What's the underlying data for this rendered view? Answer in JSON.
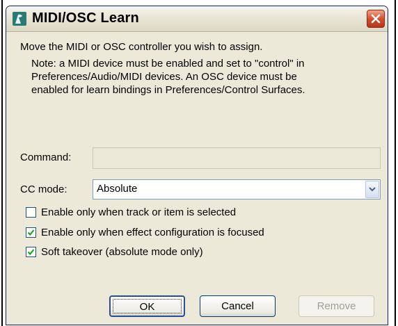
{
  "window": {
    "title": "MIDI/OSC Learn",
    "close_icon": "close-x-icon",
    "app_icon": "reaper-icon"
  },
  "body": {
    "intro": "Move the MIDI or OSC controller you wish to assign.",
    "note_lines": [
      "Note: a MIDI device must be enabled and set to \"control\" in",
      "Preferences/Audio/MIDI devices. An OSC device must be",
      "enabled for learn bindings in Preferences/Control Surfaces."
    ]
  },
  "form": {
    "command_label": "Command:",
    "command_value": "",
    "cc_mode_label": "CC mode:",
    "cc_mode_value": "Absolute"
  },
  "checkboxes": [
    {
      "label": "Enable only when track or item is selected",
      "checked": false
    },
    {
      "label": "Enable only when effect configuration is focused",
      "checked": true
    },
    {
      "label": "Soft takeover (absolute mode only)",
      "checked": true
    }
  ],
  "buttons": {
    "ok": "OK",
    "cancel": "Cancel",
    "remove": "Remove"
  },
  "colors": {
    "dialog_bg": "#ece9d8",
    "close_button": "#d1502d",
    "check_mark": "#21a121"
  }
}
